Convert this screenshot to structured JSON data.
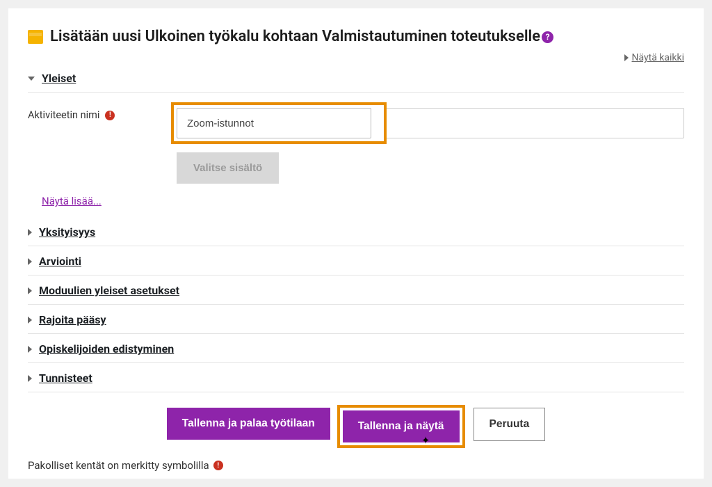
{
  "header": {
    "title": "Lisätään uusi Ulkoinen työkalu kohtaan Valmistautuminen toteutukselle"
  },
  "topright": {
    "expand_all": "Näytä kaikki"
  },
  "sections": {
    "general": {
      "title": "Yleiset",
      "activity_name_label": "Aktiviteetin nimi",
      "activity_name_value": "Zoom-istunnot",
      "select_content_label": "Valitse sisältö",
      "show_more": "Näytä lisää..."
    },
    "privacy": {
      "title": "Yksityisyys"
    },
    "grade": {
      "title": "Arviointi"
    },
    "common": {
      "title": "Moduulien yleiset asetukset"
    },
    "restrict": {
      "title": "Rajoita pääsy"
    },
    "completion": {
      "title": "Opiskelijoiden edistyminen"
    },
    "tags": {
      "title": "Tunnisteet"
    }
  },
  "actions": {
    "save_return": "Tallenna ja palaa työtilaan",
    "save_display": "Tallenna ja näytä",
    "cancel": "Peruuta"
  },
  "footnote": "Pakolliset kentät on merkitty symbolilla",
  "icons": {
    "help": "?",
    "required": "!"
  }
}
